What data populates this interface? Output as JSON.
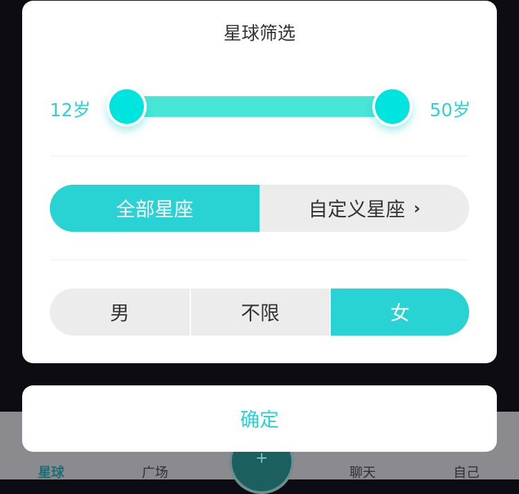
{
  "tabs": [
    {
      "label": "星球",
      "active": true
    },
    {
      "label": "广场",
      "active": false
    },
    {
      "label": "聊天",
      "active": false
    },
    {
      "label": "自己",
      "active": false
    }
  ],
  "dialog": {
    "title": "星球筛选",
    "age_min": "12岁",
    "age_max": "50岁",
    "zodiac": {
      "all_label": "全部星座",
      "custom_label": "自定义星座",
      "custom_chevron": "›",
      "selected": "all"
    },
    "gender": {
      "male": "男",
      "any": "不限",
      "female": "女",
      "selected": "female"
    }
  },
  "confirm_label": "确定",
  "accent_color": "#2ad3d3"
}
